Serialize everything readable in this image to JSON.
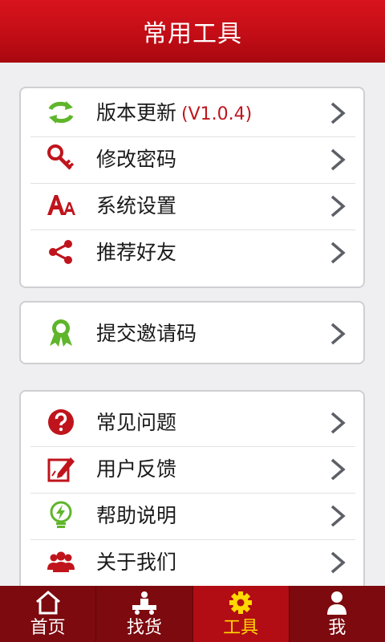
{
  "header": {
    "title": "常用工具"
  },
  "section1": {
    "items": [
      {
        "label": "版本更新",
        "version": "(V1.0.4)",
        "icon": "refresh-icon"
      },
      {
        "label": "修改密码",
        "icon": "key-icon"
      },
      {
        "label": "系统设置",
        "icon": "font-size-icon"
      },
      {
        "label": "推荐好友",
        "icon": "share-icon"
      }
    ]
  },
  "section2": {
    "items": [
      {
        "label": "提交邀请码",
        "icon": "ribbon-award-icon"
      }
    ]
  },
  "section3": {
    "items": [
      {
        "label": "常见问题",
        "icon": "question-circle-icon"
      },
      {
        "label": "用户反馈",
        "icon": "edit-feedback-icon"
      },
      {
        "label": "帮助说明",
        "icon": "lightbulb-icon"
      },
      {
        "label": "关于我们",
        "icon": "users-icon"
      }
    ]
  },
  "tabbar": {
    "tabs": [
      {
        "label": "首页",
        "icon": "home-icon"
      },
      {
        "label": "找货",
        "icon": "truck-icon"
      },
      {
        "label": "工具",
        "icon": "gear-icon",
        "active": true
      },
      {
        "label": "我",
        "icon": "person-icon"
      }
    ]
  },
  "colors": {
    "header_red": "#c30d16",
    "tabbar_bg": "#7c0a0f",
    "tab_active_bg": "#b20d14",
    "tab_active_text": "#ffd800",
    "icon_green": "#5fb52b",
    "icon_red": "#c0141c"
  }
}
